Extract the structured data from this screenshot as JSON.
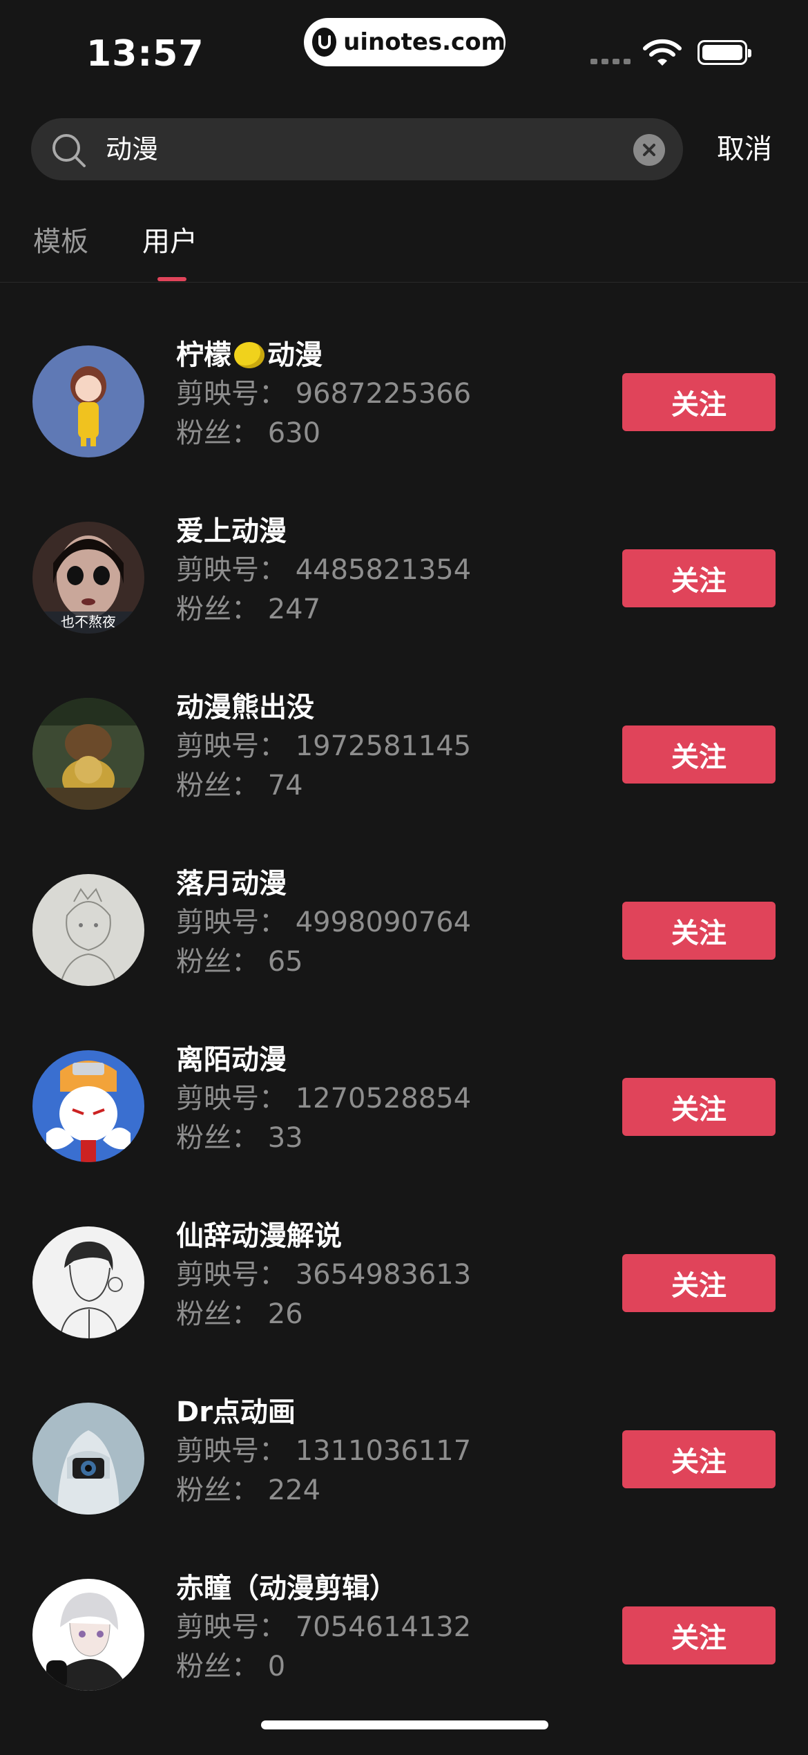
{
  "status_bar": {
    "time": "13:57",
    "site": "uinotes.com"
  },
  "search": {
    "query": "动漫",
    "cancel_label": "取消"
  },
  "tabs": [
    {
      "label": "模板",
      "active": false
    },
    {
      "label": "用户",
      "active": true
    }
  ],
  "colors": {
    "accent": "#e0445a",
    "background": "#161616"
  },
  "users": [
    {
      "name_pre": "柠檬",
      "name_post": "动漫",
      "id_line": "剪映号：  9687225366",
      "fans_line": "粉丝：  630",
      "follow_label": "关注"
    },
    {
      "name": "爱上动漫",
      "avatar_caption": "也不熬夜",
      "id_line": "剪映号：  4485821354",
      "fans_line": "粉丝：  247",
      "follow_label": "关注"
    },
    {
      "name": "动漫熊出没",
      "id_line": "剪映号：  1972581145",
      "fans_line": "粉丝：  74",
      "follow_label": "关注"
    },
    {
      "name": "落月动漫",
      "id_line": "剪映号：  4998090764",
      "fans_line": "粉丝：  65",
      "follow_label": "关注"
    },
    {
      "name": "离陌动漫",
      "id_line": "剪映号：  1270528854",
      "fans_line": "粉丝：  33",
      "follow_label": "关注"
    },
    {
      "name": "仙辞动漫解说",
      "id_line": "剪映号：  3654983613",
      "fans_line": "粉丝：  26",
      "follow_label": "关注"
    },
    {
      "name": "Dr点动画",
      "id_line": "剪映号：  1311036117",
      "fans_line": "粉丝：  224",
      "follow_label": "关注"
    },
    {
      "name": "赤瞳（动漫剪辑）",
      "id_line": "剪映号：  7054614132",
      "fans_line": "粉丝：  0",
      "follow_label": "关注"
    }
  ]
}
